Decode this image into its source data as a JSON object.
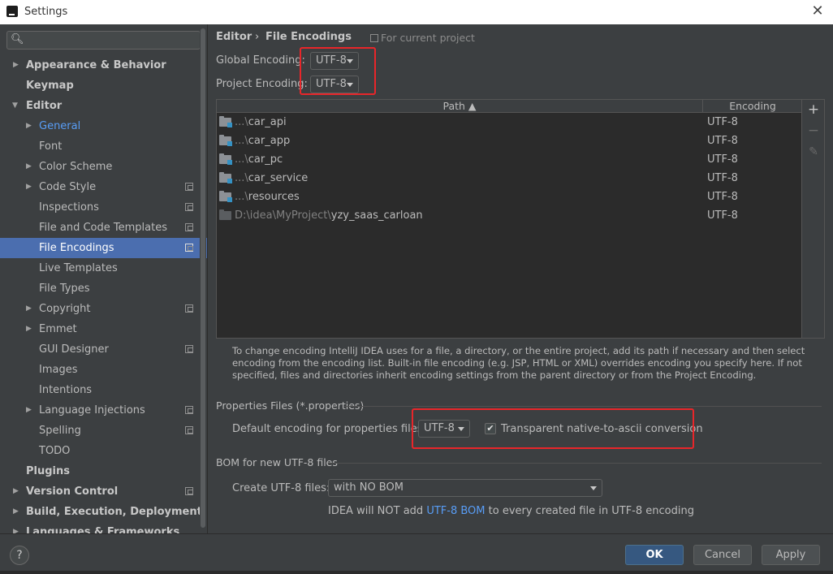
{
  "window": {
    "title": "Settings",
    "close_glyph": "✕"
  },
  "search": {
    "icon": "magnifier-icon",
    "placeholder": ""
  },
  "sidebar": {
    "items": [
      {
        "label": "Appearance & Behavior",
        "arrow": "▶"
      },
      {
        "label": "Keymap"
      },
      {
        "label": "Editor",
        "arrow": "▼"
      },
      {
        "label": "General",
        "arrow": "▶"
      },
      {
        "label": "Font"
      },
      {
        "label": "Color Scheme",
        "arrow": "▶"
      },
      {
        "label": "Code Style",
        "arrow": "▶"
      },
      {
        "label": "Inspections"
      },
      {
        "label": "File and Code Templates"
      },
      {
        "label": "File Encodings"
      },
      {
        "label": "Live Templates"
      },
      {
        "label": "File Types"
      },
      {
        "label": "Copyright",
        "arrow": "▶"
      },
      {
        "label": "Emmet",
        "arrow": "▶"
      },
      {
        "label": "GUI Designer"
      },
      {
        "label": "Images"
      },
      {
        "label": "Intentions"
      },
      {
        "label": "Language Injections",
        "arrow": "▶"
      },
      {
        "label": "Spelling"
      },
      {
        "label": "TODO"
      },
      {
        "label": "Plugins"
      },
      {
        "label": "Version Control",
        "arrow": "▶"
      },
      {
        "label": "Build, Execution, Deployment",
        "arrow": "▶"
      },
      {
        "label": "Languages & Frameworks",
        "arrow": "▶"
      }
    ]
  },
  "breadcrumb": {
    "parent": "Editor",
    "separator": "›",
    "current": "File Encodings",
    "scope": "For current project"
  },
  "global_encoding": {
    "label": "Global Encoding:",
    "value": "UTF-8"
  },
  "project_encoding": {
    "label": "Project Encoding:",
    "value": "UTF-8"
  },
  "table": {
    "headers": {
      "path": "Path ▲",
      "encoding": "Encoding"
    },
    "rows": [
      {
        "path_dim": "...\\",
        "path": "car_api",
        "encoding": "UTF-8"
      },
      {
        "path_dim": "...\\",
        "path": "car_app",
        "encoding": "UTF-8"
      },
      {
        "path_dim": "...\\",
        "path": "car_pc",
        "encoding": "UTF-8"
      },
      {
        "path_dim": "...\\",
        "path": "car_service",
        "encoding": "UTF-8"
      },
      {
        "path_dim": "...\\",
        "path": "resources",
        "encoding": "UTF-8"
      },
      {
        "path_dim": "D:\\idea\\MyProject\\",
        "path": "yzy_saas_carloan",
        "encoding": "UTF-8"
      }
    ],
    "toolbar": {
      "add": "+",
      "remove": "−",
      "edit": "✎"
    }
  },
  "help_text": "To change encoding IntelliJ IDEA uses for a file, a directory, or the entire project, add its path if necessary and then select encoding from the encoding list. Built-in file encoding (e.g. JSP, HTML or XML) overrides encoding you specify here. If not specified, files and directories inherit encoding settings from the parent directory or from the Project Encoding.",
  "properties": {
    "section_title": "Properties Files (*.properties)",
    "label": "Default encoding for properties files:",
    "value": "UTF-8",
    "native_to_ascii": {
      "checked": true,
      "check_glyph": "✔",
      "label": "Transparent native-to-ascii conversion"
    }
  },
  "bom": {
    "section_title": "BOM for new UTF-8 files",
    "label": "Create UTF-8 files:",
    "value": "with NO BOM",
    "note_prefix": "IDEA will NOT add ",
    "note_link": "UTF-8 BOM",
    "note_suffix": " to every created file in UTF-8 encoding"
  },
  "buttons": {
    "help": "?",
    "ok": "OK",
    "cancel": "Cancel",
    "apply": "Apply"
  },
  "colors": {
    "background": "#3c3f41",
    "selection": "#4b6eaf",
    "link": "#589df6",
    "highlight_box": "#e8262a",
    "ok_button": "#365880"
  }
}
